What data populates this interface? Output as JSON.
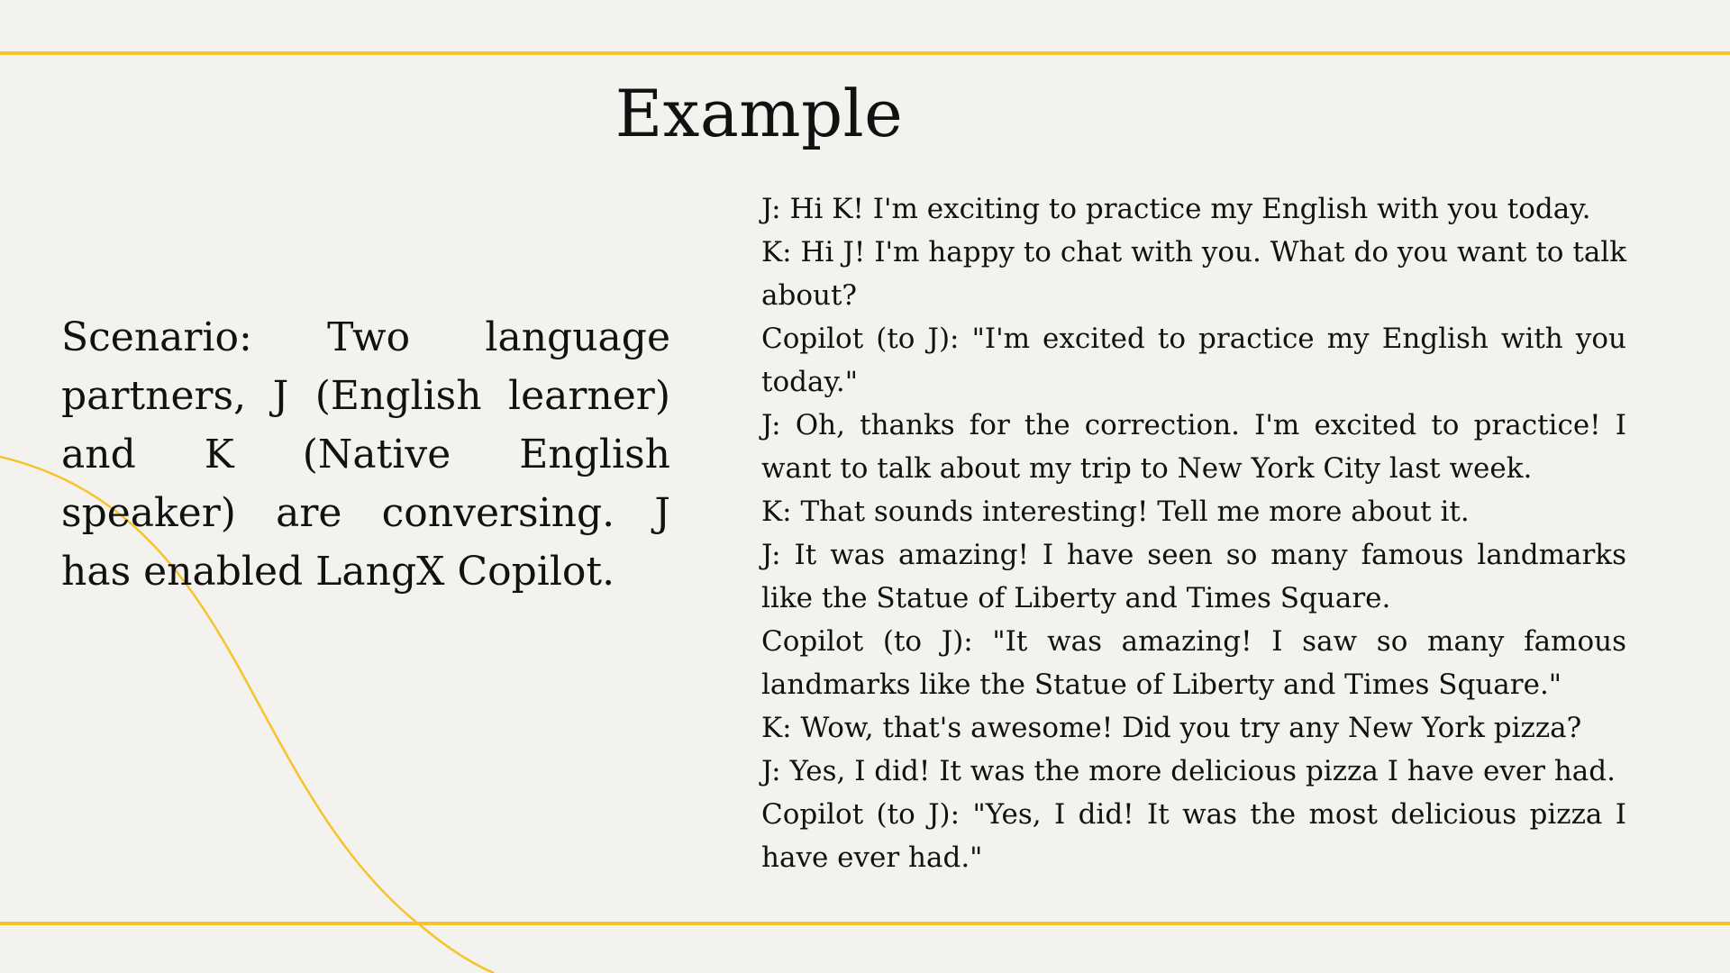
{
  "title": "Example",
  "scenario": "Scenario: Two language partners, J (English learner) and K (Native English speaker) are conversing. J has enabled LangX Copilot.",
  "dialogue": [
    "J: Hi K! I'm exciting to practice my English with you today.",
    "K: Hi J! I'm happy to chat with you. What do you want to talk about?",
    "Copilot (to J): \"I'm excited to practice my English with you today.\"",
    "J: Oh, thanks for the correction. I'm excited to practice! I want to talk about my trip to New York City last week.",
    "K: That sounds interesting! Tell me more about it.",
    "J: It was amazing! I have seen so many famous landmarks like the Statue of Liberty and Times Square.",
    "Copilot (to J): \"It was amazing! I saw so many famous landmarks like the Statue of Liberty and Times Square.\"",
    "K: Wow, that's awesome! Did you try any New York pizza?",
    "J: Yes, I did! It was the more delicious pizza I have ever had.",
    "Copilot (to J): \"Yes, I did! It was the most delicious pizza I have ever had.\""
  ],
  "colors": {
    "background": "#f4f2ee",
    "accent": "#f6c32a",
    "text": "#111111"
  }
}
